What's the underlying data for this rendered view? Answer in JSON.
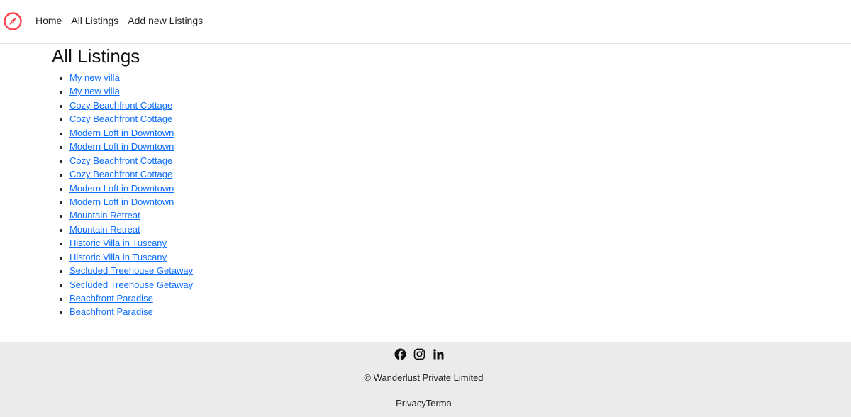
{
  "brand": {
    "icon": "compass-icon",
    "color": "#fe424d"
  },
  "nav": {
    "links": [
      "Home",
      "All Listings",
      "Add new Listings"
    ]
  },
  "main": {
    "title": "All Listings",
    "listings": [
      "My new villa",
      "My new villa",
      "Cozy Beachfront Cottage",
      "Cozy Beachfront Cottage",
      "Modern Loft in Downtown",
      "Modern Loft in Downtown",
      "Cozy Beachfront Cottage",
      "Cozy Beachfront Cottage",
      "Modern Loft in Downtown",
      "Modern Loft in Downtown",
      "Mountain Retreat",
      "Mountain Retreat",
      "Historic Villa in Tuscany",
      "Historic Villa in Tuscany",
      "Secluded Treehouse Getaway",
      "Secluded Treehouse Getaway",
      "Beachfront Paradise",
      "Beachfront Paradise"
    ]
  },
  "footer": {
    "social_icons": [
      "facebook-icon",
      "instagram-icon",
      "linkedin-icon"
    ],
    "copyright": "© Wanderlust Private Limited",
    "privacy": "Privacy",
    "terms": "Terma"
  },
  "colors": {
    "link": "#0d6efd",
    "footer_bg": "#ebebeb",
    "brand": "#fe424d"
  }
}
